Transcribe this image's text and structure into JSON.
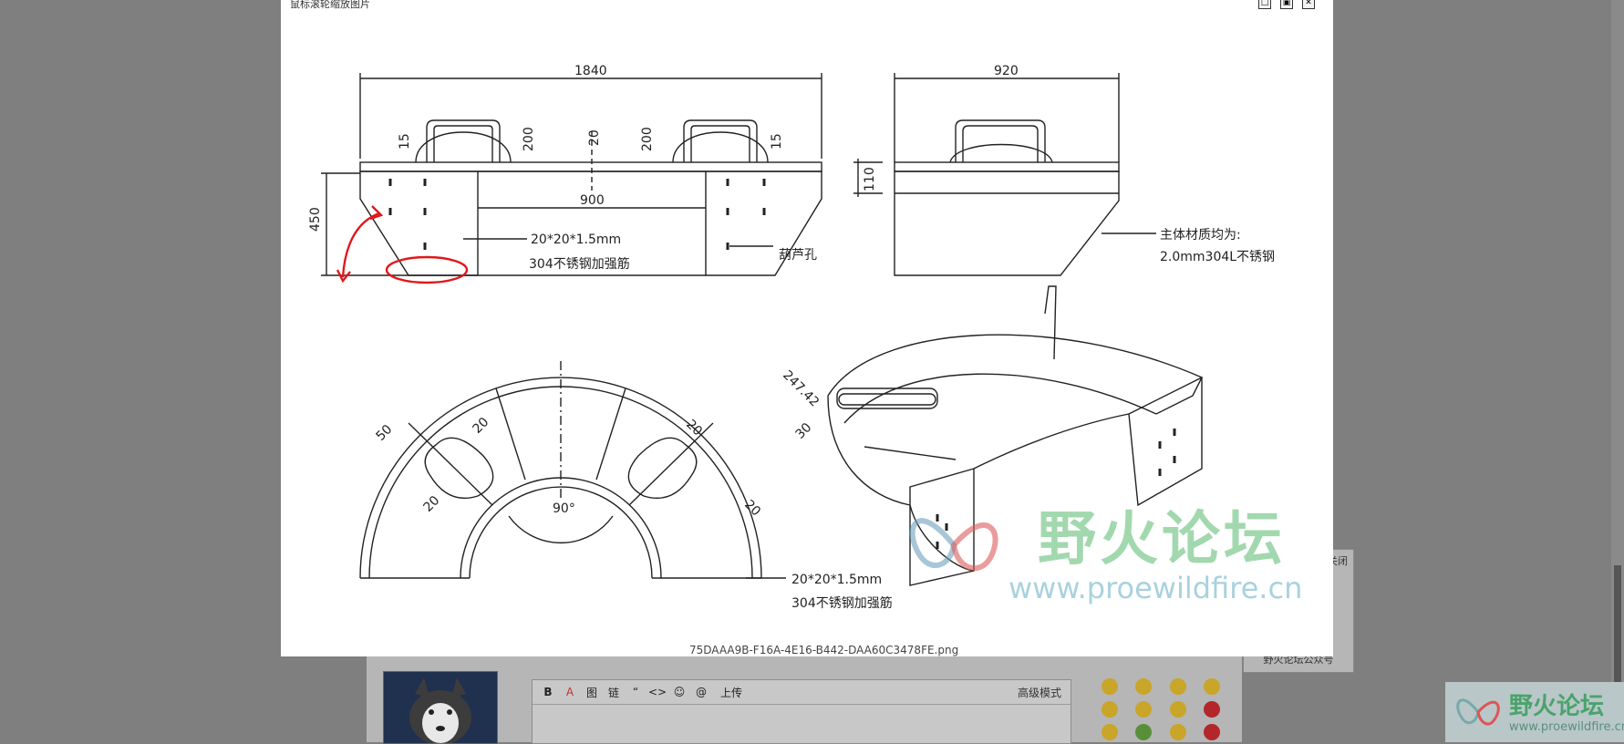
{
  "lightbox": {
    "title": "鼠标滚轮缩放图片",
    "filename": "75DAAA9B-F16A-4E16-B442-DAA60C3478FE.png",
    "controls": [
      "restore",
      "original-size",
      "close"
    ]
  },
  "drawing": {
    "dims": {
      "total_width": "1840",
      "side_width": "920",
      "height": "450",
      "handle_h_left": "15",
      "handle_200_left": "200",
      "center_20": "20",
      "handle_200_right": "200",
      "handle_h_right": "15",
      "inner_width": "900",
      "side_110": "110",
      "arc_50": "50",
      "arc_20a": "20",
      "arc_20b": "20",
      "arc_20c": "20",
      "arc_20d": "20",
      "arc_247": "247.42",
      "arc_30": "30",
      "angle_90": "90°"
    },
    "notes": {
      "rib_spec": "20*20*1.5mm",
      "rib_material": "304不锈钢加强筋",
      "hole": "葫芦孔",
      "material_1": "主体材质均为:",
      "material_2": "2.0mm304L不锈钢",
      "rib_spec2": "20*20*1.5mm",
      "rib_material2": "304不锈钢加强筋"
    },
    "watermark": {
      "cn": "野火论坛",
      "url": "www.proewildfire.cn"
    }
  },
  "background": {
    "editor_toolbar": [
      "B",
      "A",
      "图",
      "链",
      "“",
      "<>",
      "☺",
      "@"
    ],
    "upload_label": "上传",
    "advanced_mode": "高级模式",
    "qr_close": "关闭",
    "qr_label": "野火论坛公众号",
    "corner_logo_cn": "野火论坛",
    "corner_logo_url": "www.proewildfire.cn"
  },
  "colors": {
    "overlay": "#7f7f7f",
    "annotation_red": "#e0181b",
    "watermark_green": "#64be78"
  }
}
